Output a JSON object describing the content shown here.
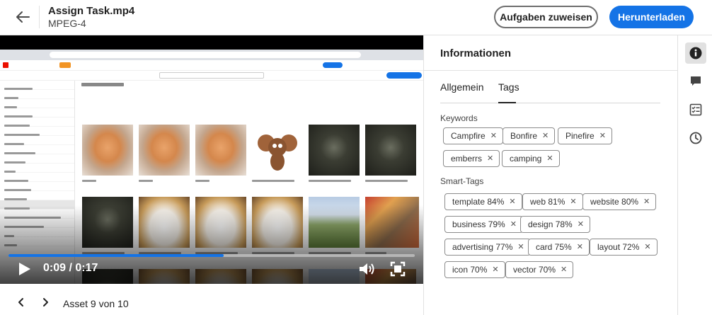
{
  "header": {
    "title": "Assign Task.mp4",
    "subtitle": "MPEG-4",
    "assign_label": "Aufgaben zuweisen",
    "download_label": "Herunterladen"
  },
  "player": {
    "current_time": "0:09",
    "duration": "0:17",
    "timecode": "0:09 / 0:17",
    "progress": 0.53
  },
  "pager": {
    "label": "Asset 9 von 10"
  },
  "info_panel": {
    "title": "Informationen",
    "tabs": [
      {
        "label": "Allgemein",
        "active": false
      },
      {
        "label": "Tags",
        "active": true
      }
    ],
    "keywords_label": "Keywords",
    "keywords": [
      "Campfire",
      "Bonfire",
      "Pinefire",
      "emberrs",
      "camping"
    ],
    "smart_tags_label": "Smart-Tags",
    "smart_tags": [
      "template 84%",
      "web 81%",
      "website 80%",
      "business 79%",
      "design 78%",
      "advertising 77%",
      "card 75%",
      "layout 72%",
      "icon 70%",
      "vector 70%"
    ]
  },
  "right_rail": {
    "icons": [
      "info-icon",
      "comment-icon",
      "tasks-icon",
      "history-icon"
    ],
    "active": "info-icon"
  },
  "colors": {
    "accent": "#1473e6",
    "video_bg": "#000000",
    "border": "#e1e1e1"
  }
}
